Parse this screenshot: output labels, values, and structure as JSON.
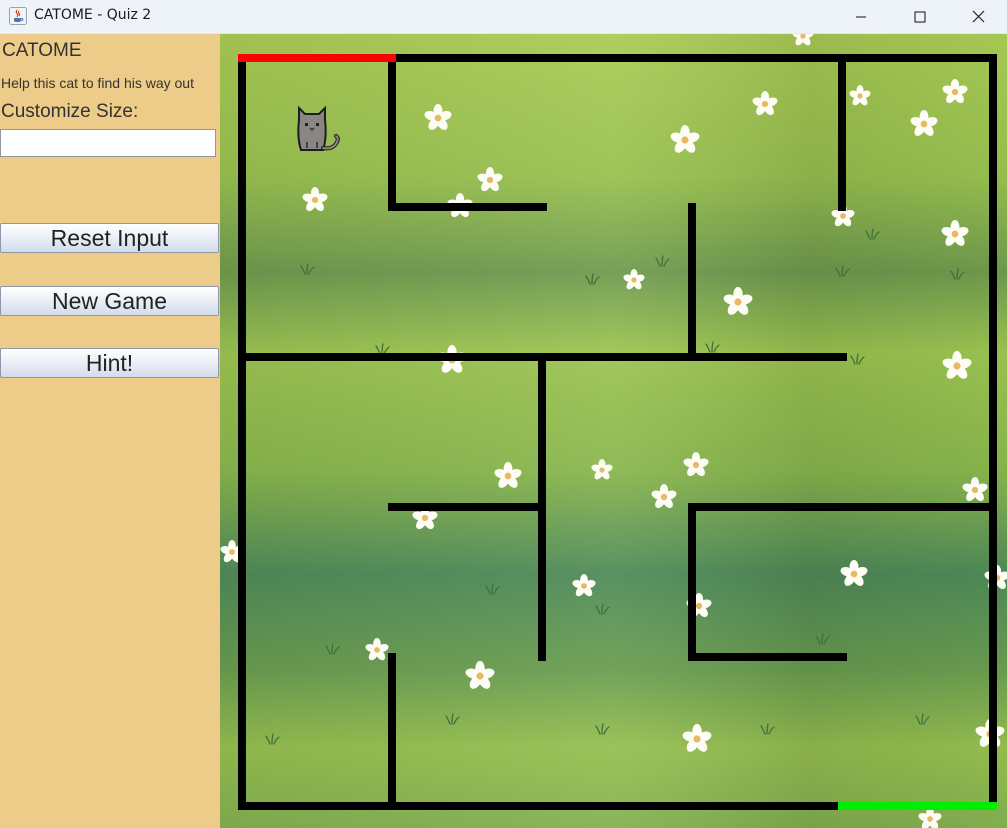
{
  "window": {
    "title": "CATOME - Quiz 2",
    "controls": [
      "minimize-icon",
      "maximize-icon",
      "close-icon"
    ]
  },
  "panel": {
    "app_title": "CATOME",
    "subtitle": "Help this cat to find his way out",
    "size_label": "Customize Size:",
    "size_input_value": "",
    "reset_label": "Reset Input",
    "new_game_label": "New Game",
    "hint_label": "Hint!"
  },
  "maze": {
    "rows": 5,
    "cols": 5,
    "entrance": "top-left",
    "exit": "bottom-right",
    "colors": {
      "wall": "#000000",
      "entrance": "#ff0000",
      "exit": "#00ee00",
      "panel": "#eccc88"
    },
    "player": "cat-icon"
  }
}
